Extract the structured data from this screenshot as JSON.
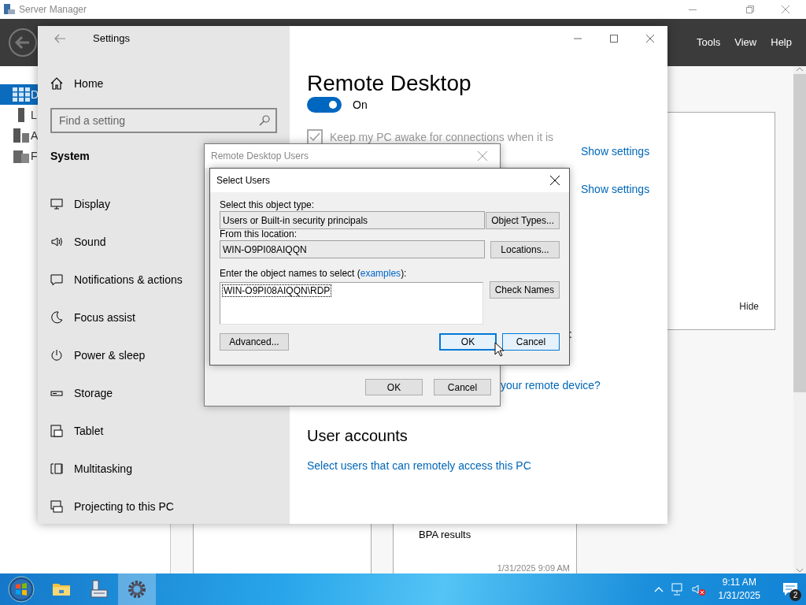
{
  "server_manager": {
    "title": "Server Manager",
    "menu": [
      "Tools",
      "View",
      "Help"
    ],
    "nav": [
      {
        "label": "D",
        "selected": true
      },
      {
        "label": "L",
        "selected": false
      },
      {
        "label": "A",
        "selected": false
      },
      {
        "label": "F",
        "selected": false
      }
    ],
    "panel": {
      "hide": "Hide"
    },
    "tiles": [
      {
        "title": "BPA results",
        "time": "1/31/2025 9:09 AM"
      }
    ]
  },
  "settings": {
    "title": "Settings",
    "home": "Home",
    "search": {
      "placeholder": "Find a setting"
    },
    "section": "System",
    "items": [
      {
        "kind": "display",
        "label": "Display"
      },
      {
        "kind": "sound",
        "label": "Sound"
      },
      {
        "kind": "notifications",
        "label": "Notifications & actions"
      },
      {
        "kind": "focus",
        "label": "Focus assist"
      },
      {
        "kind": "power",
        "label": "Power & sleep"
      },
      {
        "kind": "storage",
        "label": "Storage"
      },
      {
        "kind": "tablet",
        "label": "Tablet"
      },
      {
        "kind": "multitasking",
        "label": "Multitasking"
      },
      {
        "kind": "projecting",
        "label": "Projecting to this PC"
      }
    ],
    "page": {
      "heading": "Remote Desktop",
      "toggle": {
        "on": true,
        "label": "On"
      },
      "keep_awake": {
        "checked": true,
        "disabled": true,
        "label": "Keep my PC awake for connections when it is"
      },
      "show_settings": [
        "Show settings",
        "Show settings"
      ],
      "partial_text": ":",
      "remote_device_link": "your remote device?",
      "user_accounts_heading": "User accounts",
      "users_link": "Select users that can remotely access this PC"
    }
  },
  "remote_desktop_users": {
    "title": "Remote Desktop Users",
    "buttons": [
      "OK",
      "Cancel"
    ]
  },
  "select_users": {
    "title": "Select Users",
    "object_type_label": "Select this object type:",
    "object_type": "Users or Built-in security principals",
    "object_types_button": "Object Types...",
    "location_label": "From this location:",
    "location": "WIN-O9PI08AIQQN",
    "locations_button": "Locations...",
    "names_label": "Enter the object names to select (",
    "examples_link": "examples",
    "names_label_end": "):",
    "names_value": "WIN-O9PI08AIQQN\\RDP",
    "check_names_button": "Check Names",
    "advanced_button": "Advanced...",
    "buttons": [
      {
        "label": "OK",
        "focused": true,
        "hovered": false
      },
      {
        "label": "Cancel",
        "focused": false,
        "hovered": true
      }
    ]
  },
  "taskbar": {
    "apps": [
      {
        "kind": "explorer",
        "selected": false
      },
      {
        "kind": "server",
        "selected": false
      },
      {
        "kind": "settings",
        "selected": true
      }
    ],
    "time": "9:11 AM",
    "date": "1/31/2025",
    "notifications": "2"
  }
}
